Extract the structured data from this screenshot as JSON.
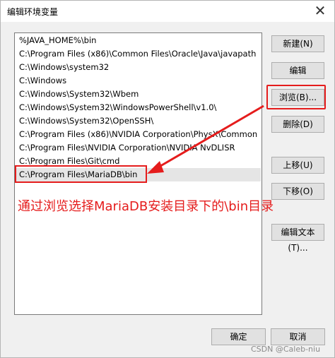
{
  "window": {
    "title": "编辑环境变量",
    "close_glyph": "✕"
  },
  "list": {
    "items": [
      "%JAVA_HOME%\\bin",
      "C:\\Program Files (x86)\\Common Files\\Oracle\\Java\\javapath",
      "C:\\Windows\\system32",
      "C:\\Windows",
      "C:\\Windows\\System32\\Wbem",
      "C:\\Windows\\System32\\WindowsPowerShell\\v1.0\\",
      "C:\\Windows\\System32\\OpenSSH\\",
      "C:\\Program Files (x86)\\NVIDIA Corporation\\PhysX\\Common",
      "C:\\Program Files\\NVIDIA Corporation\\NVIDIA NvDLISR",
      "C:\\Program Files\\Git\\cmd",
      "C:\\Program Files\\MariaDB\\bin"
    ]
  },
  "buttons": {
    "new": "新建(N)",
    "edit": "编辑",
    "browse": "浏览(B)...",
    "delete": "删除(D)",
    "move_up": "上移(U)",
    "move_down": "下移(O)",
    "edit_text": "编辑文本(T)...",
    "ok": "确定",
    "cancel": "取消"
  },
  "annotation": {
    "text": "通过浏览选择MariaDB安装目录下的\\bin目录",
    "color": "#e51c1c"
  },
  "watermark": "CSDN @Caleb-niu"
}
